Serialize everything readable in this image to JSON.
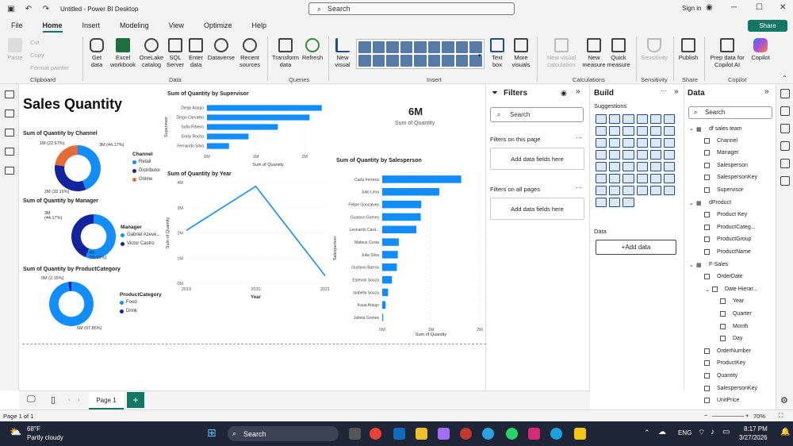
{
  "window": {
    "title": "Untitled - Power BI Desktop",
    "search_placeholder": "Search",
    "signin": "Sign in"
  },
  "menu": {
    "tabs": [
      "File",
      "Home",
      "Insert",
      "Modeling",
      "View",
      "Optimize",
      "Help"
    ],
    "share": "Share"
  },
  "ribbon": {
    "clipboard": {
      "paste": "Paste",
      "cut": "Cut",
      "copy": "Copy",
      "format_painter": "Format painter",
      "group": "Clipboard"
    },
    "data": {
      "get_data": "Get data",
      "excel": "Excel workbook",
      "onelake": "OneLake catalog",
      "sql": "SQL Server",
      "enter": "Enter data",
      "dataverse": "Dataverse",
      "recent": "Recent sources",
      "group": "Data"
    },
    "queries": {
      "transform": "Transform data",
      "refresh": "Refresh",
      "group": "Queries"
    },
    "insert": {
      "new_visual": "New visual",
      "text_box": "Text box",
      "more_visuals": "More visuals",
      "group": "Insert"
    },
    "calc": {
      "new_visual_calc": "New visual calculation",
      "new_measure": "New measure",
      "quick_measure": "Quick measure",
      "group": "Calculations"
    },
    "sensitivity": {
      "label": "Sensitivity",
      "group": "Sensitivity"
    },
    "share": {
      "publish": "Publish",
      "group": "Share"
    },
    "copilot": {
      "prep": "Prep data for Copilot AI",
      "copilot": "Copilot",
      "group": "Copilot"
    }
  },
  "report": {
    "title": "Sales Quantity",
    "card": {
      "value": "6M",
      "label": "Sum of Quantity"
    },
    "channel": {
      "title": "Sum of Quantity by Channel",
      "legend_title": "Channel",
      "legend": [
        "Retail",
        "Distributor",
        "Online"
      ],
      "labels": [
        "1M (22.67%)",
        "3M (44.17%)",
        "2M (33.16%)"
      ]
    },
    "manager": {
      "title": "Sum of Quantity by Manager",
      "legend_title": "Manager",
      "legend": [
        "Gabriel Azeve...",
        "Victor Castro"
      ],
      "labels": [
        "3M (44.17%)",
        "4M (55.83%)"
      ]
    },
    "category": {
      "title": "Sum of Quantity by ProductCategory",
      "legend_title": "ProductCategory",
      "legend": [
        "Food",
        "Drink"
      ],
      "labels": [
        "0M (2.15%)",
        "6M (97.85%)"
      ]
    },
    "supervisor": {
      "title": "Sum of Quantity by Supervisor",
      "ylabel": "Supervisor",
      "xlabel": "Sum of Quantity",
      "ticks": [
        "0M",
        "1M",
        "2M"
      ]
    },
    "year": {
      "title": "Sum of Quantity by Year",
      "ylabel": "Sum of Quantity",
      "xlabel": "Year",
      "yticks": [
        "4M",
        "3M",
        "2M",
        "1M",
        "0M"
      ],
      "xticks": [
        "2019",
        "2020",
        "2021"
      ]
    },
    "salesperson": {
      "title": "Sum of Quantity by Salesperson",
      "ylabel": "Salesperson",
      "xlabel": "Sum of Quantity",
      "ticks": [
        "0M",
        "1M",
        "2M"
      ]
    },
    "page_tab": "Page 1"
  },
  "chart_data": [
    {
      "type": "pie",
      "title": "Sum of Quantity by Channel",
      "categories": [
        "Retail",
        "Distributor",
        "Online"
      ],
      "values": [
        44.17,
        33.16,
        22.67
      ],
      "colors": [
        "#118DFF",
        "#12239E",
        "#E66C37"
      ]
    },
    {
      "type": "pie",
      "title": "Sum of Quantity by Manager",
      "categories": [
        "Gabriel Azeve...",
        "Victor Castro"
      ],
      "values": [
        55.83,
        44.17
      ],
      "colors": [
        "#118DFF",
        "#12239E"
      ]
    },
    {
      "type": "pie",
      "title": "Sum of Quantity by ProductCategory",
      "categories": [
        "Food",
        "Drink"
      ],
      "values": [
        97.85,
        2.15
      ],
      "colors": [
        "#118DFF",
        "#12239E"
      ]
    },
    {
      "type": "bar",
      "title": "Sum of Quantity by Supervisor",
      "categories": [
        "Diego Araujo",
        "Diogo Carvalho",
        "Sofia Ribeiro",
        "Emily Rocha",
        "Fernando Silva"
      ],
      "values": [
        2.35,
        2.1,
        1.45,
        0.85,
        0.45
      ],
      "xlim": [
        0,
        2.5
      ]
    },
    {
      "type": "line",
      "title": "Sum of Quantity by Year",
      "x": [
        "2019",
        "2020",
        "2021"
      ],
      "values": [
        2.1,
        3.85,
        0.3
      ],
      "ylim": [
        0,
        4
      ]
    },
    {
      "type": "bar",
      "title": "Sum of Quantity by Salesperson",
      "categories": [
        "Carla Ferreira",
        "Julio Lima",
        "Felipe Goncalves",
        "Gustavo Gomes",
        "Leonardo Card...",
        "Mateus Costa",
        "Julia Silva",
        "Gustavo Barros",
        "Estevan Souza",
        "Isabella Souza",
        "Kaua Araujo",
        "Julieta Gomes"
      ],
      "values": [
        1.62,
        1.17,
        0.8,
        0.79,
        0.7,
        0.34,
        0.32,
        0.3,
        0.2,
        0.12,
        0.07,
        0.02
      ],
      "xlim": [
        0,
        2
      ]
    }
  ],
  "filters": {
    "title": "Filters",
    "search": "Search",
    "on_page": "Filters on this page",
    "add": "Add data fields here",
    "all_pages": "Filters on all pages"
  },
  "build": {
    "title": "Build",
    "suggestions": "Suggestions",
    "data": "Data",
    "add_data": "+Add data"
  },
  "datapane": {
    "title": "Data",
    "search": "Search",
    "items": [
      {
        "t": "df sales team",
        "lvl": 0,
        "table": true
      },
      {
        "t": "Channel",
        "lvl": 1
      },
      {
        "t": "Manager",
        "lvl": 1
      },
      {
        "t": "Salesperson",
        "lvl": 1
      },
      {
        "t": "SalespersonKey",
        "lvl": 1
      },
      {
        "t": "Supervisor",
        "lvl": 1
      },
      {
        "t": "dProduct",
        "lvl": 0,
        "table": true
      },
      {
        "t": "Product Key",
        "lvl": 1
      },
      {
        "t": "ProductCateg...",
        "lvl": 1
      },
      {
        "t": "ProductGroup",
        "lvl": 1
      },
      {
        "t": "ProductName",
        "lvl": 1
      },
      {
        "t": "F-Sales",
        "lvl": 0,
        "table": true
      },
      {
        "t": "OrderDate",
        "lvl": 1
      },
      {
        "t": "Date Hierar...",
        "lvl": 2
      },
      {
        "t": "Year",
        "lvl": 3
      },
      {
        "t": "Quarter",
        "lvl": 3
      },
      {
        "t": "Month",
        "lvl": 3
      },
      {
        "t": "Day",
        "lvl": 3
      },
      {
        "t": "OrderNumber",
        "lvl": 1
      },
      {
        "t": "ProductKey",
        "lvl": 1
      },
      {
        "t": "Quantity",
        "lvl": 1
      },
      {
        "t": "SalespersonKey",
        "lvl": 1
      },
      {
        "t": "UnitPrice",
        "lvl": 1
      }
    ]
  },
  "status": {
    "page": "Page 1 of 1",
    "zoom": "70%"
  },
  "taskbar": {
    "temp": "68°F",
    "weather": "Partly cloudy",
    "search": "Search",
    "lang": "ENG",
    "time": "8:17 PM",
    "date": "3/27/2026"
  }
}
